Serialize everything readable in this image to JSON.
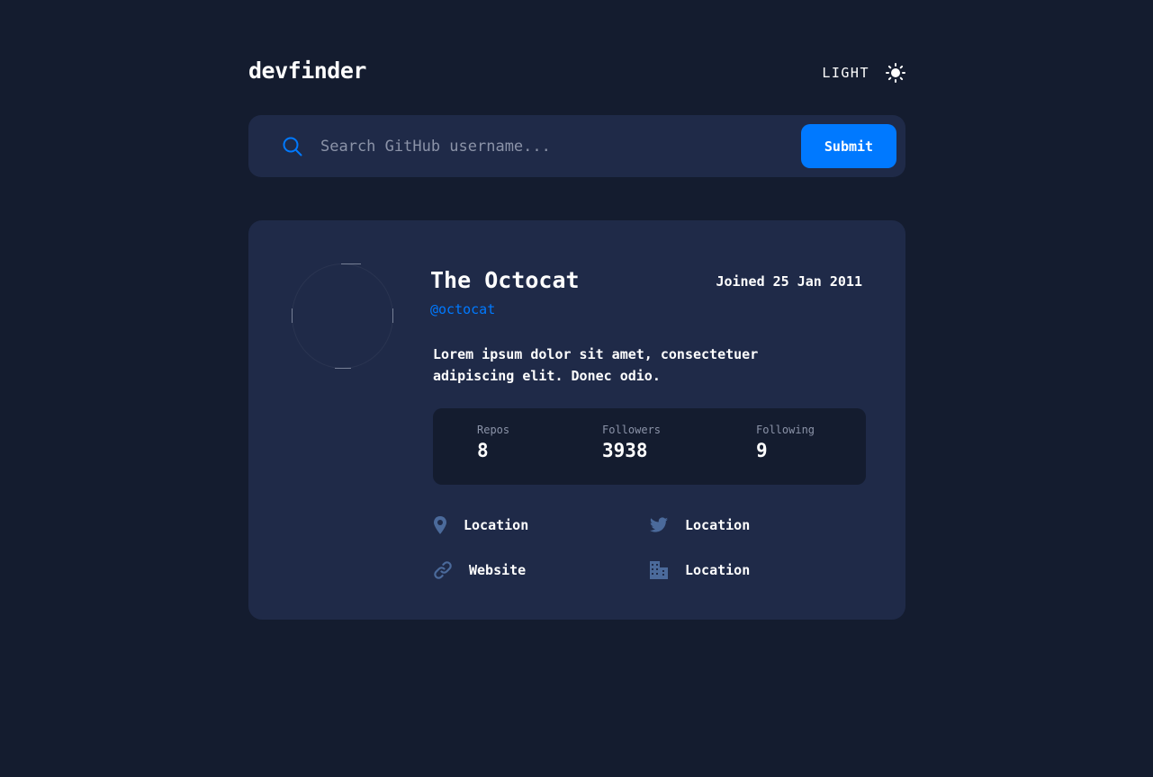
{
  "header": {
    "logo": "devfinder",
    "theme_toggle_label": "LIGHT",
    "theme_icon": "sun-icon"
  },
  "search": {
    "placeholder": "Search GitHub username...",
    "value": "",
    "icon": "search-icon",
    "submit_label": "Submit"
  },
  "profile": {
    "name": "The Octocat",
    "joined": "Joined 25 Jan 2011",
    "handle": "@octocat",
    "bio": "Lorem ipsum dolor sit amet, consectetuer adipiscing elit. Donec odio.",
    "stats": [
      {
        "label": "Repos",
        "value": "8"
      },
      {
        "label": "Followers",
        "value": "3938"
      },
      {
        "label": "Following",
        "value": "9"
      }
    ],
    "links": {
      "location": {
        "icon": "location-pin-icon",
        "text": "Location"
      },
      "twitter": {
        "icon": "twitter-icon",
        "text": "Location"
      },
      "website": {
        "icon": "link-icon",
        "text": "Website"
      },
      "company": {
        "icon": "building-icon",
        "text": "Location"
      }
    }
  },
  "colors": {
    "background": "#141c2f",
    "card": "#1f2a48",
    "accent": "#0079ff",
    "muted_text": "#8b93a8",
    "icon": "#4b6a9b"
  }
}
